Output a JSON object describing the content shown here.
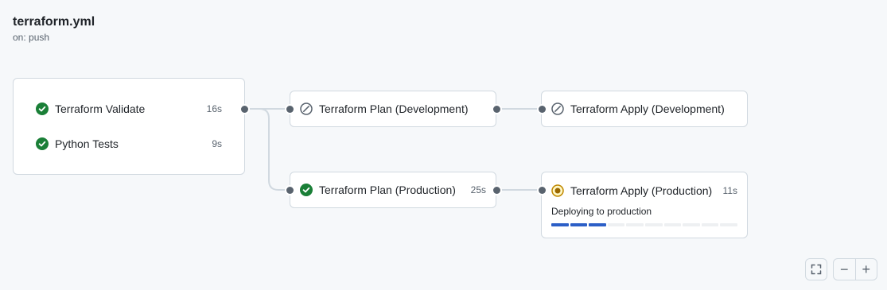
{
  "workflow": {
    "title": "terraform.yml",
    "trigger": "on: push"
  },
  "group": {
    "jobs": [
      {
        "name": "Terraform Validate",
        "duration": "16s",
        "status": "success",
        "icon": "check-circle-icon"
      },
      {
        "name": "Python Tests",
        "duration": "9s",
        "status": "success",
        "icon": "check-circle-icon"
      }
    ]
  },
  "nodes": {
    "plan_dev": {
      "name": "Terraform Plan (Development)",
      "duration": "",
      "status": "skipped",
      "icon": "skipped-icon"
    },
    "apply_dev": {
      "name": "Terraform Apply (Development)",
      "duration": "",
      "status": "skipped",
      "icon": "skipped-icon"
    },
    "plan_prod": {
      "name": "Terraform Plan (Production)",
      "duration": "25s",
      "status": "success",
      "icon": "check-circle-icon"
    },
    "apply_prod": {
      "name": "Terraform Apply (Production)",
      "duration": "11s",
      "status": "in_progress",
      "icon": "in-progress-icon",
      "deploy_prefix": "Deploying to",
      "environment": "production",
      "progress_fraction": 0.3,
      "progress_segments": 10
    }
  },
  "controls": {
    "fullscreen_icon": "fullscreen-icon",
    "zoom_out_label": "−",
    "zoom_in_label": "+"
  },
  "colors": {
    "success": "#1a7f37",
    "in_progress": "#bf8700",
    "skipped": "#59636e",
    "progress": "#2c5fc7"
  }
}
